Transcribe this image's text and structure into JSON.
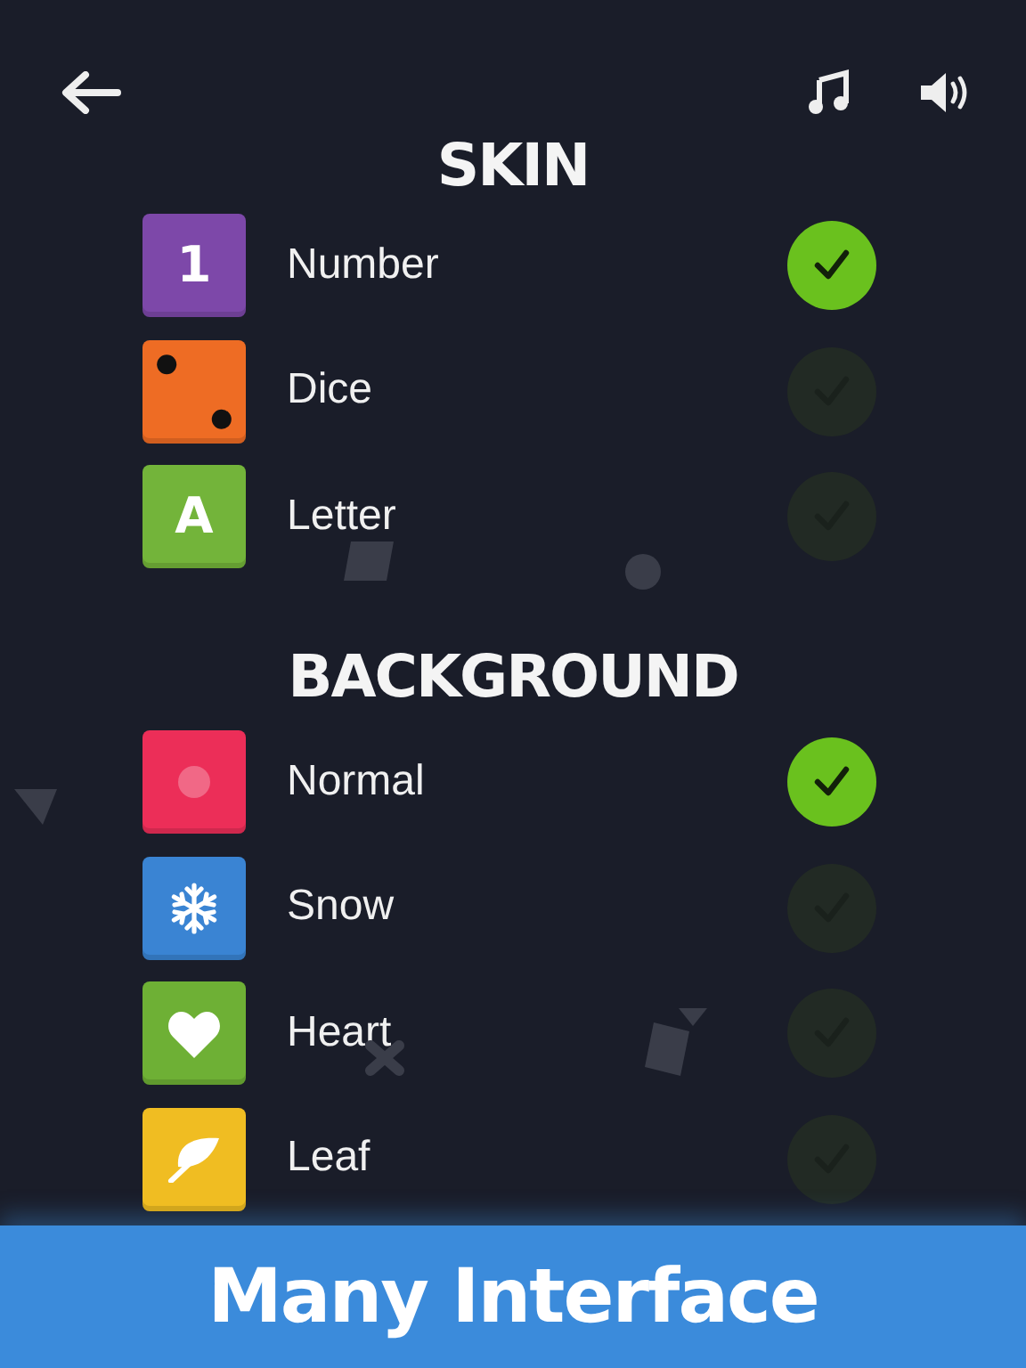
{
  "sections": [
    {
      "title": "SKIN",
      "items": [
        {
          "label": "Number",
          "kind": "number",
          "glyph": "1",
          "color": "#7d48a9",
          "selected": true
        },
        {
          "label": "Dice",
          "kind": "dice",
          "color": "#ee6c24",
          "selected": false
        },
        {
          "label": "Letter",
          "kind": "letter",
          "glyph": "A",
          "color": "#73b43a",
          "selected": false
        }
      ]
    },
    {
      "title": "BACKGROUND",
      "items": [
        {
          "label": "Normal",
          "kind": "dot",
          "color": "#ec2e58",
          "selected": true
        },
        {
          "label": "Snow",
          "kind": "snow",
          "color": "#3a84d3",
          "selected": false
        },
        {
          "label": "Heart",
          "kind": "heart",
          "color": "#6eb035",
          "selected": false
        },
        {
          "label": "Leaf",
          "kind": "leaf",
          "color": "#f0bd22",
          "selected": false
        }
      ]
    }
  ],
  "banner": {
    "text": "Many Interface"
  }
}
